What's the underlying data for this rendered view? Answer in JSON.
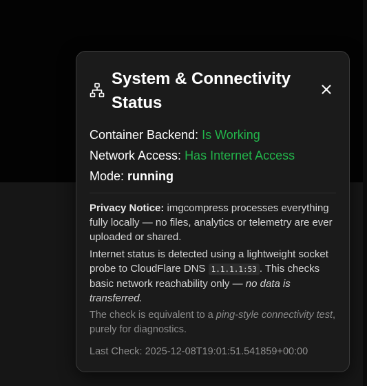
{
  "panel": {
    "title": "System & Connectivity Status",
    "icon": "network-icon",
    "close_icon": "close-icon"
  },
  "status": {
    "backend_label": "Container Backend:",
    "backend_value": "Is Working",
    "network_label": "Network Access:",
    "network_value": "Has Internet Access",
    "mode_label": "Mode:",
    "mode_value": "running",
    "ok_color": "#22b34a"
  },
  "notice": {
    "privacy_heading": "Privacy Notice:",
    "privacy_text": " imgcompress processes everything fully locally — no files, analytics or telemetry are ever uploaded or shared.",
    "probe_text_1": "Internet status is detected using a lightweight socket probe to CloudFlare DNS ",
    "probe_code": "1.1.1.1:53",
    "probe_text_2": ". This checks basic network reachability only — ",
    "probe_emphasis": "no data is transferred",
    "probe_text_3": ".",
    "check_text_1": "The check is equivalent to a ",
    "check_emphasis": "ping-style connectivity test",
    "check_text_2": ", purely for diagnostics."
  },
  "last_check": "Last Check: 2025-12-08T19:01:51.541859+00:00"
}
